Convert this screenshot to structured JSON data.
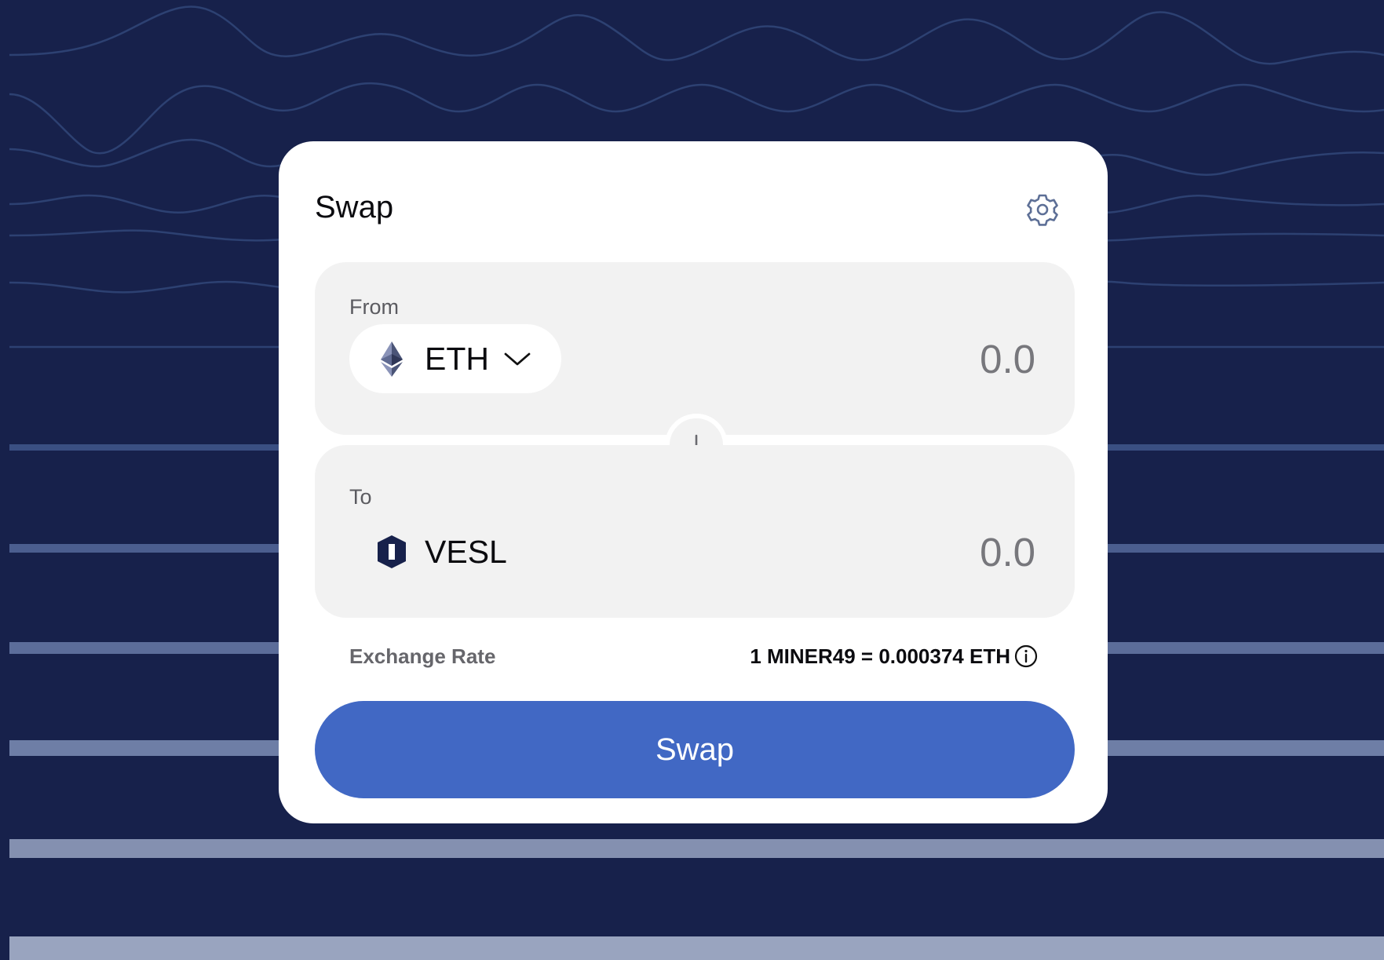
{
  "colors": {
    "background": "#17214b",
    "card": "#ffffff",
    "panel": "#f2f2f2",
    "accent": "#4168c4",
    "muted_text": "#77777c"
  },
  "header": {
    "title": "Swap",
    "settings_icon": "gear-icon"
  },
  "from": {
    "label": "From",
    "token": "ETH",
    "token_icon": "ethereum-icon",
    "dropdown_icon": "chevron-down-icon",
    "amount": "0.0"
  },
  "switch": {
    "icon": "arrow-down-icon"
  },
  "to": {
    "label": "To",
    "token": "VESL",
    "token_icon": "vesl-icon",
    "amount": "0.0"
  },
  "exchange_rate": {
    "label": "Exchange Rate",
    "value": "1 MINER49 = 0.000374 ETH",
    "info_icon": "info-icon"
  },
  "swap_button": {
    "label": "Swap"
  }
}
